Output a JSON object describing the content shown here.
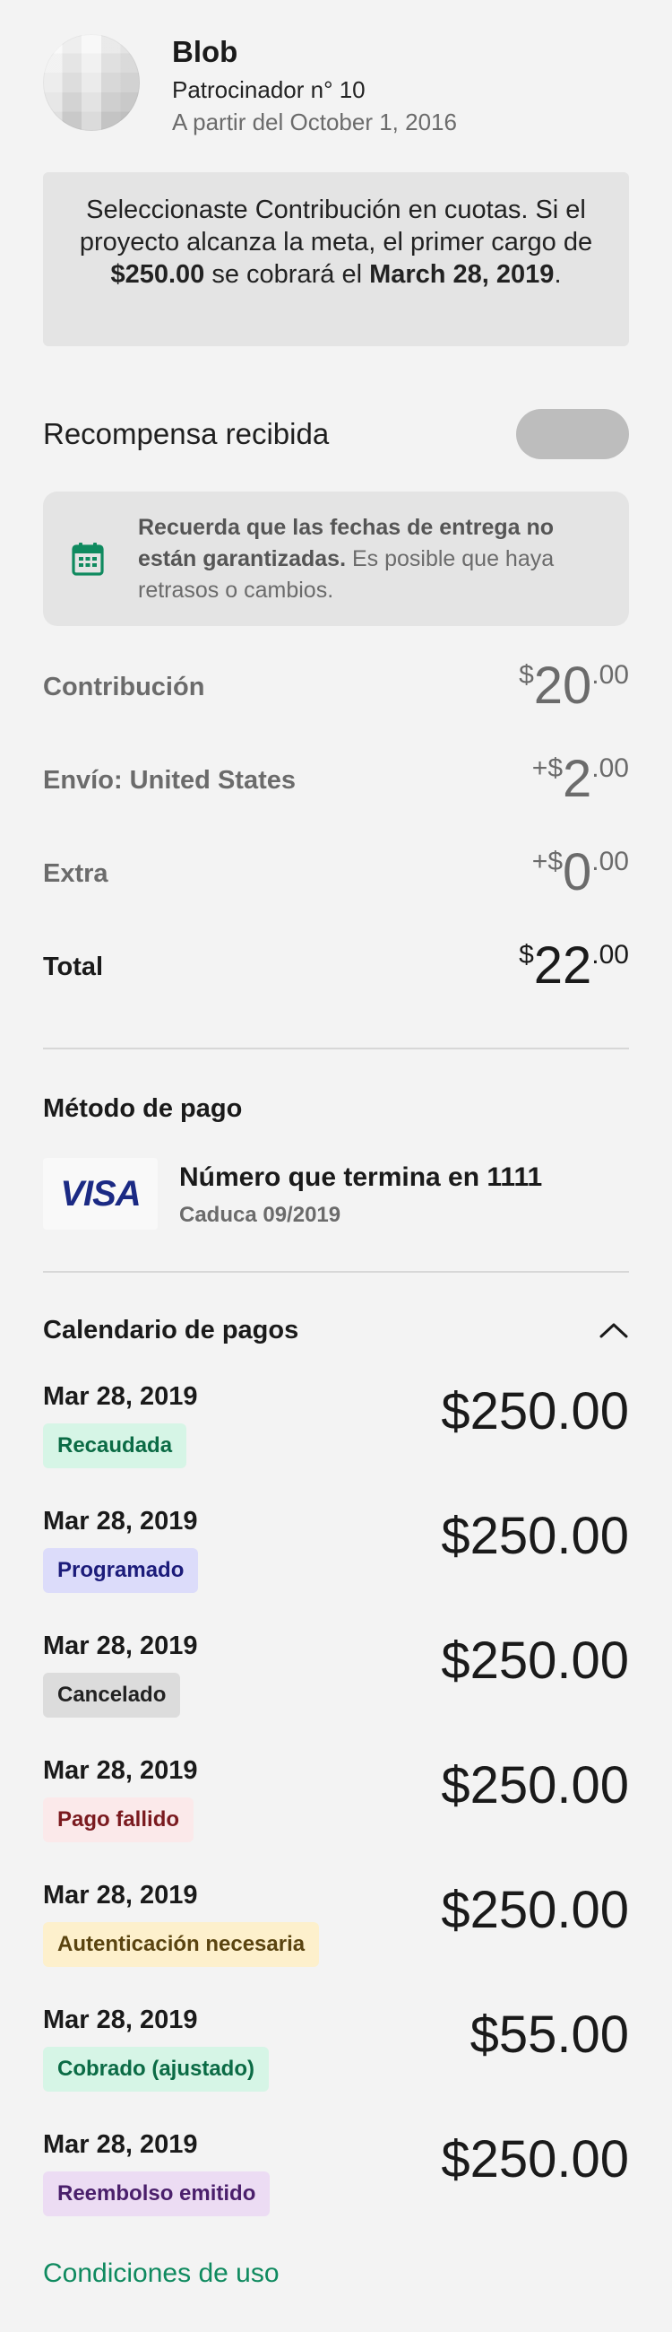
{
  "header": {
    "name": "Blob",
    "backer_number": "Patrocinador n° 10",
    "since": "A partir del October 1, 2016"
  },
  "notice": {
    "p1": "Seleccionaste Contribución en cuotas. Si el proyecto alcanza la meta, el primer cargo de ",
    "amount": "$250.00",
    "p2": " se cobrará el ",
    "date": "March 28, 2019",
    "p3": "."
  },
  "reward": {
    "label": "Recompensa recibida",
    "toggle_on": false
  },
  "delivery": {
    "bold": "Recuerda que las fechas de entrega no están garantizadas.",
    "rest": " Es posible que haya retrasos o cambios.",
    "icon": "calendar-icon",
    "icon_color": "#0f8a5f"
  },
  "amounts": [
    {
      "label": "Contribución",
      "prefix": "$",
      "whole": "20",
      "cents": ".00"
    },
    {
      "label": "Envío: United States",
      "prefix": "+$",
      "whole": "2",
      "cents": ".00"
    },
    {
      "label": "Extra",
      "prefix": "+$",
      "whole": "0",
      "cents": ".00"
    },
    {
      "label": "Total",
      "prefix": "$",
      "whole": "22",
      "cents": ".00"
    }
  ],
  "payment": {
    "title": "Método de pago",
    "card_brand": "VISA",
    "card_number": "Número que termina en 1111",
    "expiry": "Caduca 09/2019"
  },
  "schedule": {
    "title": "Calendario de pagos",
    "items": [
      {
        "date": "Mar 28, 2019",
        "status": "Recaudada",
        "amount": "$250.00",
        "bg": "#d6f5e6",
        "fg": "#0b6b45"
      },
      {
        "date": "Mar 28, 2019",
        "status": "Programado",
        "amount": "$250.00",
        "bg": "#dcdcfa",
        "fg": "#1c1c7a"
      },
      {
        "date": "Mar 28, 2019",
        "status": "Cancelado",
        "amount": "$250.00",
        "bg": "#dcdcdc",
        "fg": "#222222"
      },
      {
        "date": "Mar 28, 2019",
        "status": "Pago fallido",
        "amount": "$250.00",
        "bg": "#fbe9ea",
        "fg": "#7a1a1f"
      },
      {
        "date": "Mar 28, 2019",
        "status": "Autenticación necesaria",
        "amount": "$250.00",
        "bg": "#fdf0cc",
        "fg": "#5a4410"
      },
      {
        "date": "Mar 28, 2019",
        "status": "Cobrado (ajustado)",
        "amount": "$55.00",
        "bg": "#d6f5e6",
        "fg": "#0b6b45"
      },
      {
        "date": "Mar 28, 2019",
        "status": "Reembolso emitido",
        "amount": "$250.00",
        "bg": "#ecdcf3",
        "fg": "#4a1f6b"
      }
    ]
  },
  "footer": {
    "terms": "Condiciones de uso",
    "terms_color": "#0f8a5f"
  }
}
